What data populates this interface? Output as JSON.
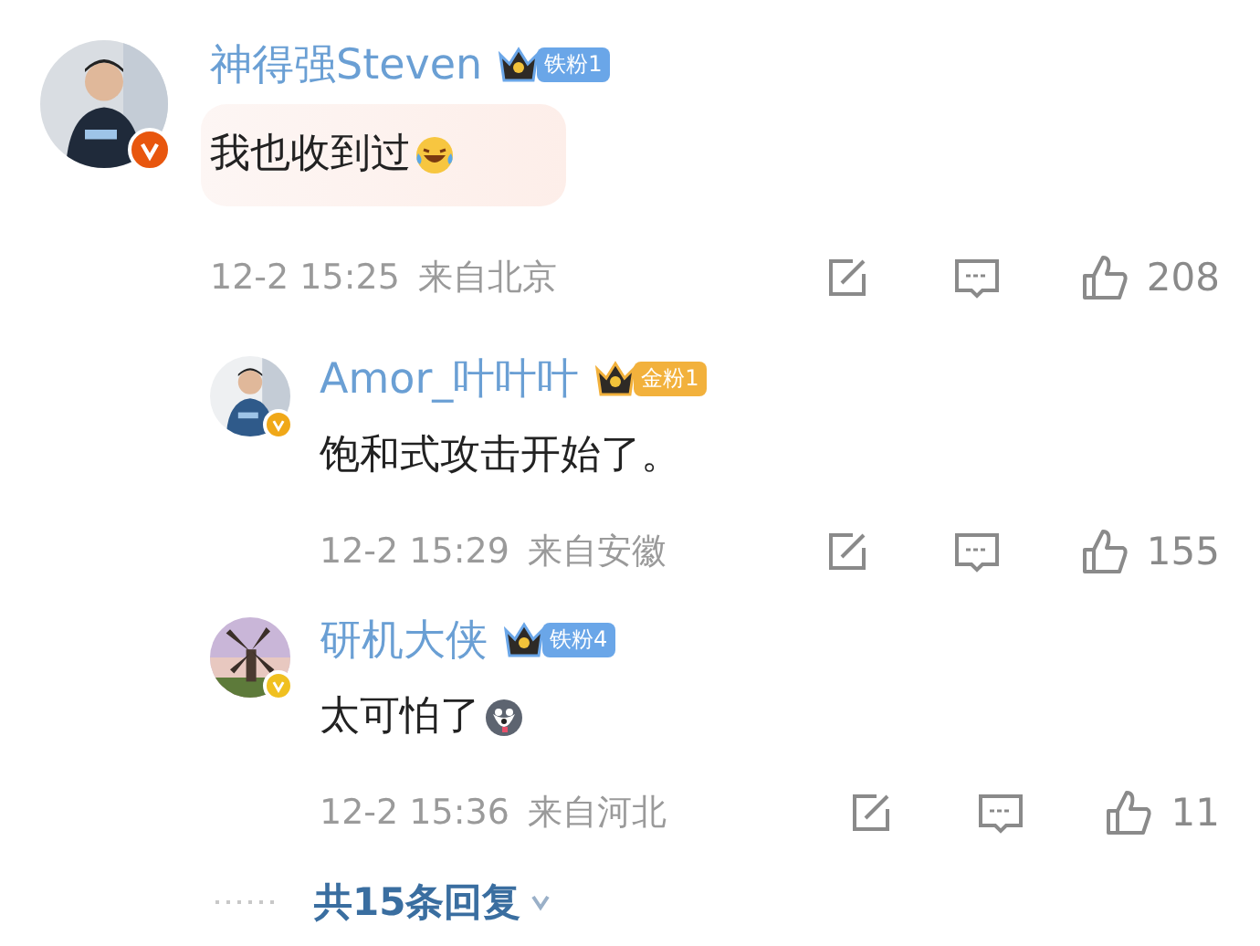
{
  "comments": [
    {
      "author": "神得强Steven",
      "kind": "main",
      "verified": {
        "color": "#e8560e"
      },
      "badge": {
        "label": "铁粉1",
        "color": "#6aa6e8"
      },
      "text": "我也收到过",
      "emoji": {
        "kind": "laughing"
      },
      "highlighted": true,
      "date": "12-2 15:25",
      "location": "来自北京",
      "likes": "208"
    },
    {
      "author": "Amor_叶叶叶",
      "kind": "reply",
      "verified": {
        "color": "#f0a818"
      },
      "badge": {
        "label": "金粉1",
        "color": "#f2b13c"
      },
      "text": "饱和式攻击开始了。",
      "highlighted": false,
      "date": "12-2 15:29",
      "location": "来自安徽",
      "likes": "155"
    },
    {
      "author": "研机大侠",
      "kind": "reply",
      "verified": {
        "color": "#f0c020"
      },
      "badge": {
        "label": "铁粉4",
        "color": "#6aa6e8"
      },
      "text": "太可怕了",
      "emoji": {
        "kind": "dog"
      },
      "highlighted": false,
      "date": "12-2 15:36",
      "location": "来自河北",
      "likes": "11"
    }
  ],
  "more_replies": {
    "label": "共15条回复"
  }
}
